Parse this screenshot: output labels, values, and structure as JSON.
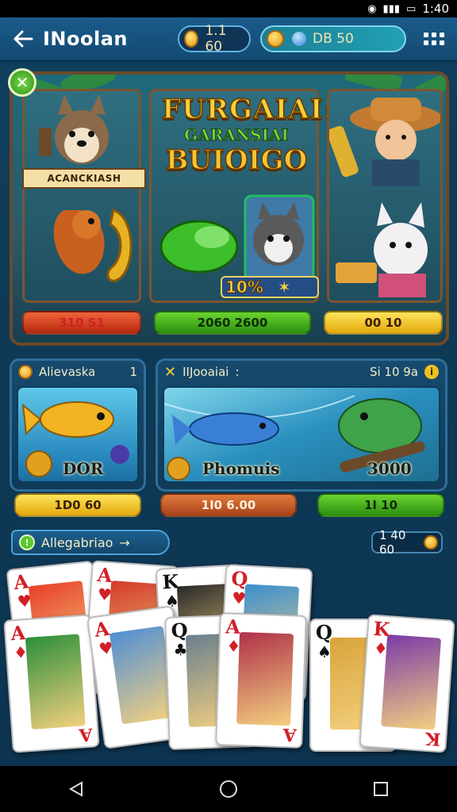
{
  "status_bar": {
    "time": "1:40"
  },
  "header": {
    "title": "INoolan",
    "coins": "1.1 60",
    "gems": "DB 50"
  },
  "banner": {
    "title_line1": "FURGAIAI:",
    "title_line2": "GARANSIAI",
    "title_line3": "BUIOIGO",
    "left_nameplate": "ACANCKIASH",
    "bonus_pct": "10%",
    "bonus_mark": "✶",
    "prizes": [
      "310 S1",
      "2060 2600",
      "00 10"
    ]
  },
  "tiles": {
    "left": {
      "title": "Alievaska",
      "count": "1",
      "label": "DOR"
    },
    "right": {
      "title": "IIJooaiai",
      "mark": ":",
      "count": "Si 10 9a",
      "label": "Phomuis",
      "label2": "3000"
    }
  },
  "price_buttons": [
    "1D0 60",
    "1I0 6.00",
    "1I 10"
  ],
  "cards_section": {
    "title": "Allegabriao",
    "arrow": "→",
    "count": "1 40 60",
    "cards": [
      {
        "rank": "A",
        "suit": "♥",
        "color": "red"
      },
      {
        "rank": "A",
        "suit": "♥",
        "color": "red"
      },
      {
        "rank": "K",
        "suit": "♠",
        "color": "black"
      },
      {
        "rank": "Q",
        "suit": "♥",
        "color": "red"
      },
      {
        "rank": "A",
        "suit": "♦",
        "color": "red"
      },
      {
        "rank": "A",
        "suit": "♥",
        "color": "red"
      },
      {
        "rank": "Q",
        "suit": "♣",
        "color": "black"
      },
      {
        "rank": "A",
        "suit": "♦",
        "color": "red"
      },
      {
        "rank": "Q",
        "suit": "♠",
        "color": "black"
      },
      {
        "rank": "K",
        "suit": "♦",
        "color": "red"
      }
    ]
  },
  "colors": {
    "header": "#1a5b8a",
    "accent_gold": "#f7d23a",
    "green_button": "#2a8f10",
    "red_button": "#b4290d"
  }
}
